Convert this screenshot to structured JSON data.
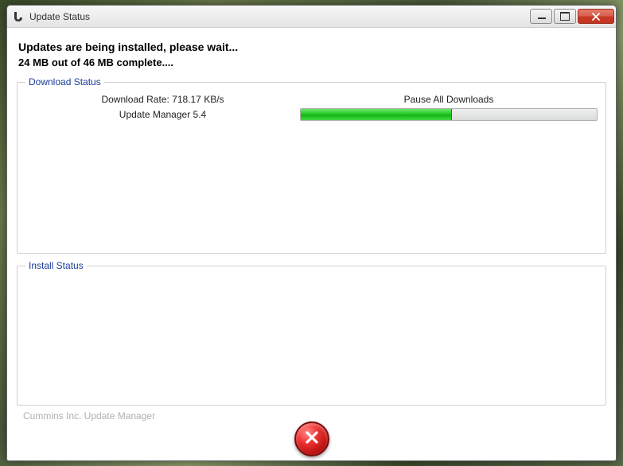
{
  "window": {
    "title": "Update Status"
  },
  "main": {
    "heading": "Updates are being installed, please wait...",
    "progress_text": "24 MB out of 46 MB complete...."
  },
  "download": {
    "legend": "Download Status",
    "rate_label": "Download Rate: 718.17 KB/s",
    "pause_label": "Pause All Downloads",
    "item_name": "Update Manager 5.4",
    "progress_percent": 51
  },
  "install": {
    "legend": "Install Status"
  },
  "footer": {
    "brand": "Cummins Inc. Update Manager"
  },
  "colors": {
    "link_blue": "#1a3c9a",
    "progress_green": "#2dcf2d",
    "close_red": "#c73a24"
  }
}
